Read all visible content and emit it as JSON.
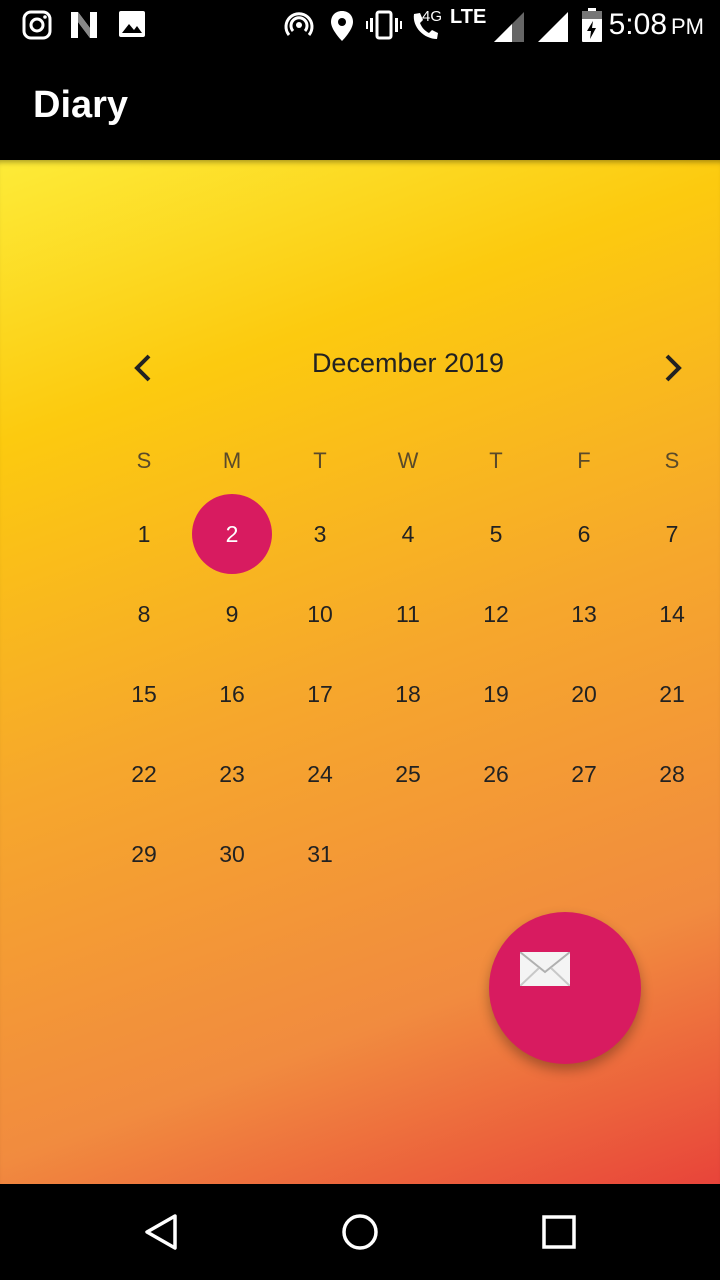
{
  "status_bar": {
    "time": "5:08",
    "ampm": "PM",
    "network_label_4g": "4G",
    "network_label_lte": "LTE",
    "icons": [
      "instagram-icon",
      "n-icon",
      "image-icon",
      "hotspot-icon",
      "location-icon",
      "vibrate-icon",
      "wifi-call-icon",
      "signal-icon",
      "signal-icon",
      "battery-charging-icon"
    ]
  },
  "app_bar": {
    "title": "Diary"
  },
  "calendar": {
    "month_label": "December 2019",
    "prev_icon": "chevron-left-icon",
    "next_icon": "chevron-right-icon",
    "weekdays": [
      "S",
      "M",
      "T",
      "W",
      "T",
      "F",
      "S"
    ],
    "days": [
      "1",
      "2",
      "3",
      "4",
      "5",
      "6",
      "7",
      "8",
      "9",
      "10",
      "11",
      "12",
      "13",
      "14",
      "15",
      "16",
      "17",
      "18",
      "19",
      "20",
      "21",
      "22",
      "23",
      "24",
      "25",
      "26",
      "27",
      "28",
      "29",
      "30",
      "31"
    ],
    "selected_day": "2",
    "selected_color": "#d81b60"
  },
  "fab": {
    "icon": "envelope-icon",
    "color": "#d81b60"
  },
  "nav_bar": {
    "icons": [
      "back-triangle-icon",
      "home-circle-icon",
      "recents-square-icon"
    ]
  }
}
